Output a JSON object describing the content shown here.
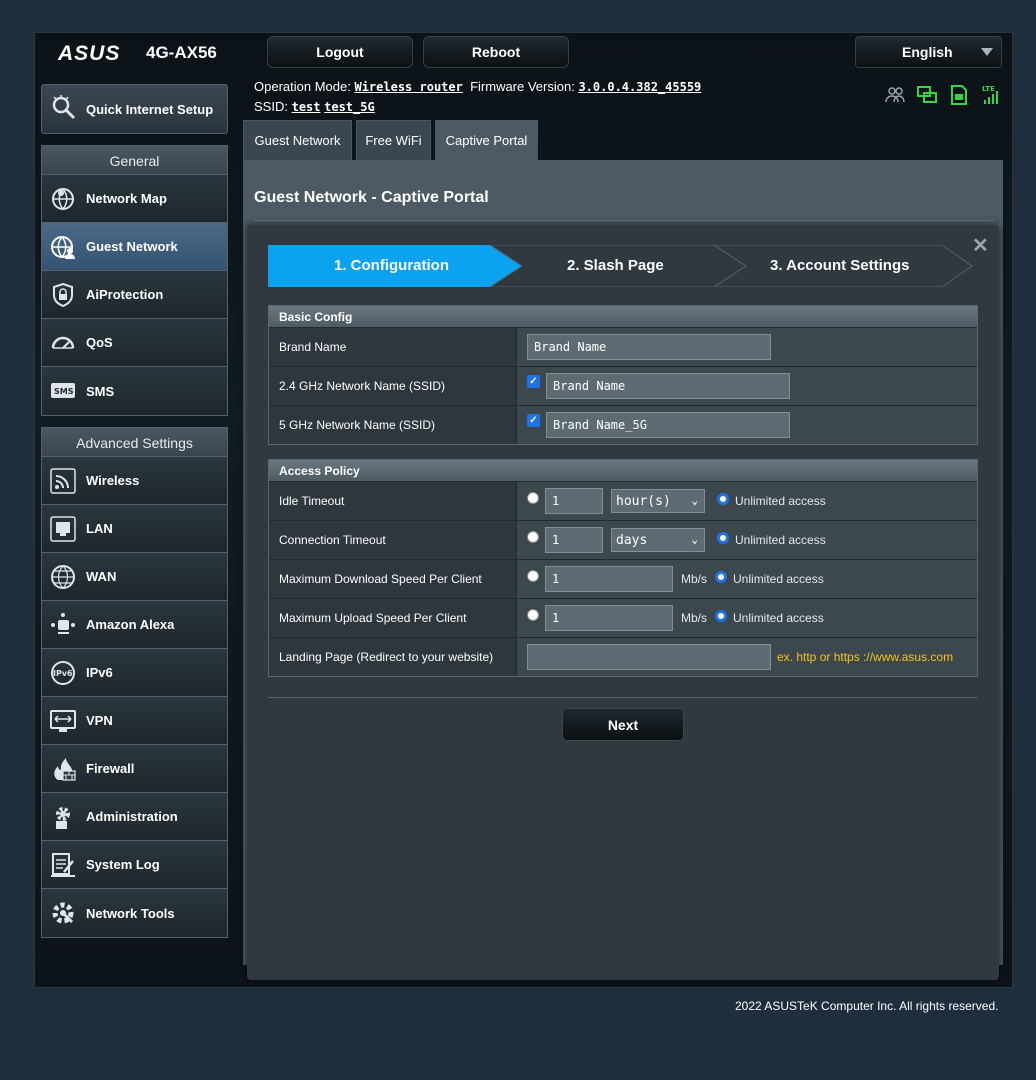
{
  "header": {
    "brand": "ASUS",
    "model": "4G-AX56",
    "logout_label": "Logout",
    "reboot_label": "Reboot",
    "language": "English",
    "op_mode_label": "Operation Mode:",
    "op_mode_value": "Wireless router",
    "firmware_label": "Firmware Version:",
    "firmware_value": "3.0.0.4.382_45559",
    "ssid_label": "SSID:",
    "ssid_values": [
      "test",
      "test_5G"
    ]
  },
  "sidebar": {
    "quick_setup": "Quick Internet Setup",
    "general_label": "General",
    "general_items": [
      {
        "label": "Network Map",
        "icon": "network-map-icon"
      },
      {
        "label": "Guest Network",
        "icon": "guest-network-icon"
      },
      {
        "label": "AiProtection",
        "icon": "shield-icon"
      },
      {
        "label": "QoS",
        "icon": "gauge-icon"
      },
      {
        "label": "SMS",
        "icon": "sms-icon"
      }
    ],
    "advanced_label": "Advanced Settings",
    "advanced_items": [
      {
        "label": "Wireless",
        "icon": "wireless-icon"
      },
      {
        "label": "LAN",
        "icon": "lan-icon"
      },
      {
        "label": "WAN",
        "icon": "globe-icon"
      },
      {
        "label": "Amazon Alexa",
        "icon": "alexa-icon"
      },
      {
        "label": "IPv6",
        "icon": "ipv6-icon"
      },
      {
        "label": "VPN",
        "icon": "vpn-icon"
      },
      {
        "label": "Firewall",
        "icon": "firewall-icon"
      },
      {
        "label": "Administration",
        "icon": "gear-icon"
      },
      {
        "label": "System Log",
        "icon": "log-icon"
      },
      {
        "label": "Network Tools",
        "icon": "tools-icon"
      }
    ]
  },
  "tabs": [
    "Guest Network",
    "Free WiFi",
    "Captive Portal"
  ],
  "page_title": "Guest Network - Captive Portal",
  "wizard": {
    "steps": [
      "1. Configuration",
      "2. Slash Page",
      "3. Account Settings"
    ]
  },
  "basic": {
    "header": "Basic Config",
    "brand_name_label": "Brand Name",
    "brand_name_value": "Brand Name",
    "ssid24_label": "2.4 GHz Network Name (SSID)",
    "ssid24_value": "Brand Name",
    "ssid5_label": "5 GHz Network Name (SSID)",
    "ssid5_value": "Brand Name_5G"
  },
  "policy": {
    "header": "Access Policy",
    "idle_label": "Idle Timeout",
    "idle_value": "1",
    "idle_unit": "hour(s)",
    "conn_label": "Connection Timeout",
    "conn_value": "1",
    "conn_unit": "days",
    "down_label": "Maximum Download Speed Per Client",
    "down_value": "1",
    "up_label": "Maximum Upload Speed Per Client",
    "up_value": "1",
    "speed_unit": "Mb/s",
    "unlimited": "Unlimited access",
    "landing_label": "Landing Page (Redirect to your website)",
    "landing_value": "",
    "landing_hint": "ex. http or https ://www.asus.com"
  },
  "next_label": "Next",
  "footer": "2022 ASUSTeK Computer Inc. All rights reserved."
}
